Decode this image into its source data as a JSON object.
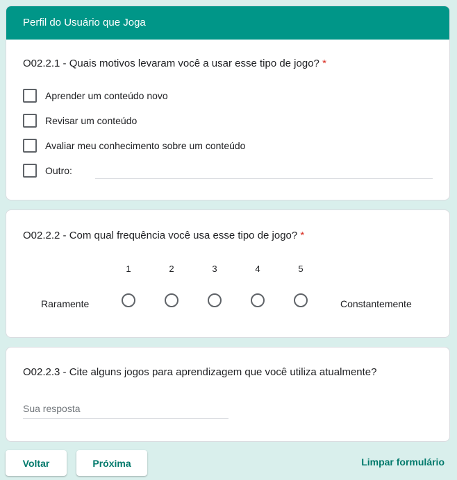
{
  "section_title": "Perfil do Usuário que Joga",
  "q1": {
    "text": "O02.2.1 - Quais motivos levaram você a usar esse tipo de jogo?",
    "required": "*",
    "options": [
      "Aprender um conteúdo novo",
      "Revisar um conteúdo",
      "Avaliar meu conhecimento sobre um conteúdo",
      "Outro:"
    ]
  },
  "q2": {
    "text": "O02.2.2 - Com qual frequência você usa esse tipo de jogo?",
    "required": "*",
    "scale": [
      "1",
      "2",
      "3",
      "4",
      "5"
    ],
    "min_label": "Raramente",
    "max_label": "Constantemente"
  },
  "q3": {
    "text": "O02.2.3 - Cite alguns jogos para aprendizagem que você utiliza atualmente?",
    "placeholder": "Sua resposta"
  },
  "nav": {
    "back": "Voltar",
    "next": "Próxima",
    "clear": "Limpar formulário"
  }
}
